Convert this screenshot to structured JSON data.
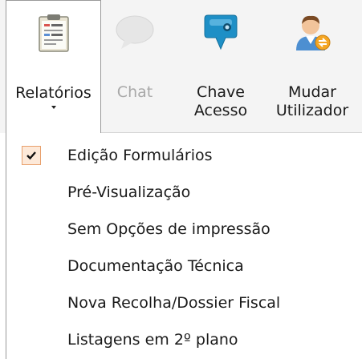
{
  "ribbon": {
    "buttons": [
      {
        "label": "Relatórios",
        "icon": "report-document-icon",
        "state": "active",
        "has_dropdown": true
      },
      {
        "label": "Chat",
        "icon": "chat-bubble-icon",
        "state": "disabled",
        "has_dropdown": false
      },
      {
        "label": "Chave\nAcesso",
        "icon": "key-icon",
        "state": "normal",
        "has_dropdown": false
      },
      {
        "label": "Mudar\nUtilizador",
        "icon": "switch-user-icon",
        "state": "normal",
        "has_dropdown": false
      }
    ]
  },
  "menu": {
    "items": [
      {
        "label": "Edição Formulários",
        "checked": true
      },
      {
        "label": "Pré-Visualização",
        "checked": false
      },
      {
        "label": "Sem Opções de impressão",
        "checked": false
      },
      {
        "label": "Documentação Técnica",
        "checked": false
      },
      {
        "label": "Nova Recolha/Dossier Fiscal",
        "checked": false
      },
      {
        "label": "Listagens em 2º plano",
        "checked": false
      }
    ]
  },
  "colors": {
    "check_background": "#fde9d9",
    "check_border": "#e8a06c",
    "key_blue": "#1e8fc6",
    "disabled_text": "#a8a8a8"
  }
}
